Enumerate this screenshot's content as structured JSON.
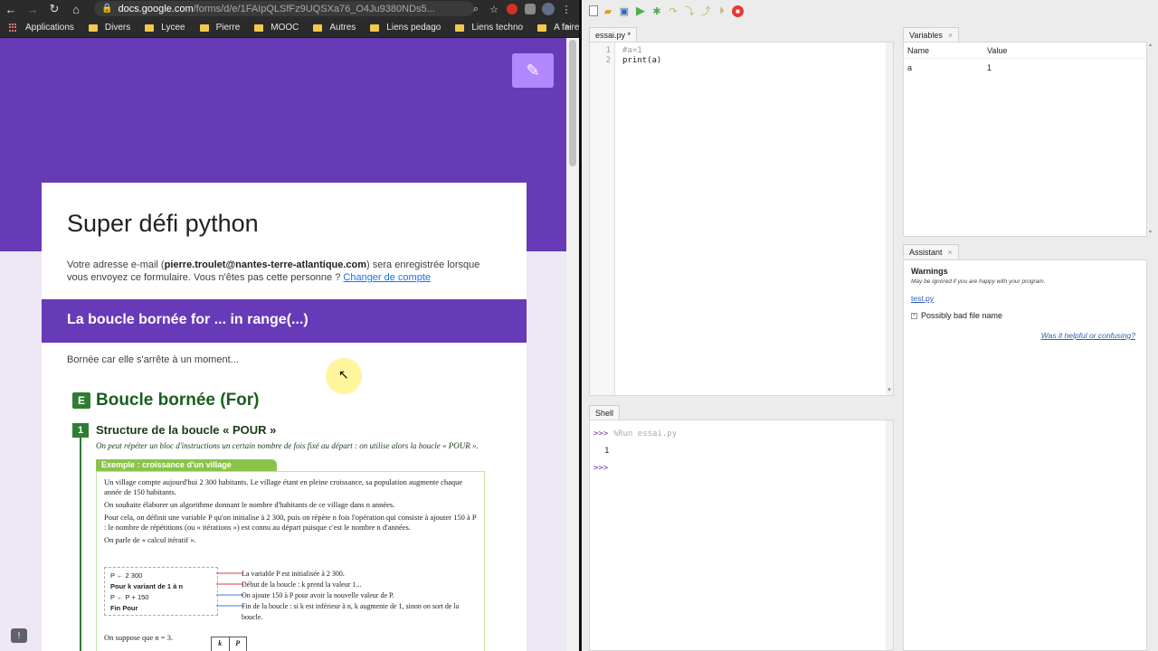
{
  "browser": {
    "url_host": "docs.google.com",
    "url_rest": "/forms/d/e/1FAIpQLSfFz9UQSXa76_O4Ju9380NDs5...",
    "bookmarks": [
      {
        "label": "Applications",
        "icon": "apps-icon"
      },
      {
        "label": "Divers",
        "icon": "folder-icon"
      },
      {
        "label": "Lycee",
        "icon": "folder-icon"
      },
      {
        "label": "Pierre",
        "icon": "folder-icon"
      },
      {
        "label": "MOOC",
        "icon": "folder-icon"
      },
      {
        "label": "Autres",
        "icon": "folder-icon"
      },
      {
        "label": "Liens pedago",
        "icon": "folder-icon"
      },
      {
        "label": "Liens techno",
        "icon": "folder-icon"
      },
      {
        "label": "A faire",
        "icon": "folder-icon"
      }
    ],
    "bookmarks_more": "»"
  },
  "form": {
    "title": "Super défi python",
    "desc_before": "Votre adresse e-mail (",
    "email": "pierre.troulet@nantes-terre-atlantique.com",
    "desc_after": ") sera enregistrée lorsque vous envoyez ce formulaire. Vous n'êtes pas cette personne ? ",
    "change_account": "Changer de compte",
    "section_title": "La boucle bornée for ... in range(...)",
    "section_desc": "Bornée car elle s'arrête à un moment...",
    "header_color": "#673ab7"
  },
  "book": {
    "badge": "E",
    "heading": "Boucle bornée (For)",
    "num": "1",
    "subheading": "Structure de la boucle « POUR »",
    "intro": "On peut répéter un bloc d'instructions un certain nombre de fois fixé au départ : on utilise alors la boucle « POUR ».",
    "example_tag": "Exemple : croissance d'un village",
    "p1": "Un village compte aujourd'hui 2 300 habitants. Le village étant en pleine croissance, sa population augmente chaque année de 150 habitants.",
    "p2": "On souhaite élaborer un algorithme donnant le nombre d'habitants de ce village dans n années.",
    "p3": "Pour cela, on définit une variable P qu'on initialise à 2 300, puis on répète n fois l'opération qui consiste à ajouter 150 à P : le nombre de répétitions (ou « itérations ») est connu au départ puisque c'est le nombre n d'années.",
    "p4": "On parle de « calcul itératif ».",
    "algo": [
      "P ← 2 300",
      "Pour k variant de 1 à n",
      "   P ← P + 150",
      "Fin Pour"
    ],
    "notes": [
      "La variable P est initialisée à 2 300.",
      "Début de la boucle : k prend la valeur 1...",
      "On ajoute 150 à P pour avoir la nouvelle valeur de P.",
      "Fin de la boucle : si k est inférieur à n, k augmente de 1, sinon on sort de la boucle."
    ],
    "suppose": "On suppose que n = 3.",
    "table_headers": [
      "k",
      "P"
    ]
  },
  "ide": {
    "editor_tab": "essai.py *",
    "line_numbers": [
      "1",
      "2"
    ],
    "code_lines": [
      "#a=1",
      "print(a)"
    ],
    "shell_tab": "Shell",
    "shell": {
      "prompt": ">>>",
      "cmd": "%Run essai.py",
      "output": "1",
      "prompt2": ">>>"
    },
    "variables_tab": "Variables",
    "var_headers": {
      "name": "Name",
      "value": "Value"
    },
    "variables": [
      {
        "name": "a",
        "value": "1"
      }
    ],
    "assistant_tab": "Assistant",
    "assistant": {
      "warnings_title": "Warnings",
      "warnings_sub": "May be ignored if you are happy with your program.",
      "file_link": "test.py",
      "item": "Possibly bad file name",
      "help_link": "Was it helpful or confusing?"
    }
  }
}
